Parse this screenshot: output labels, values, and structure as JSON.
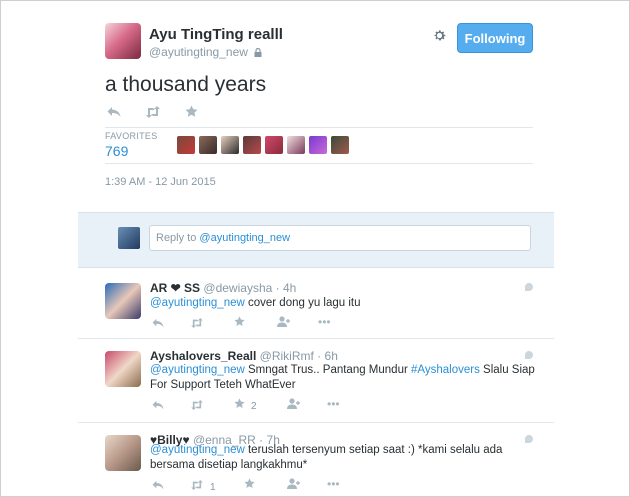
{
  "main_tweet": {
    "name": "Ayu TingTing realll",
    "handle": "@ayutingting_new",
    "follow_label": "Following",
    "text": "a thousand years",
    "favorites_label": "FAVORITES",
    "favorites_count": "769",
    "timestamp": "1:39 AM - 12 Jun 2015"
  },
  "reply": {
    "prefix": "Reply to ",
    "mention": "@ayutingting_new"
  },
  "replies": [
    {
      "name": "AR ❤ SS",
      "handle": "@dewiaysha",
      "time": "4h",
      "mention": "@ayutingting_new",
      "text": " cover dong yu lagu itu",
      "fav_count": ""
    },
    {
      "name": "Ayshalovers_Reall",
      "handle": "@RikiRmf",
      "time": "6h",
      "mention": "@ayutingting_new",
      "text_before_hashtag": " Smngat Trus.. Pantang Mundur ",
      "hashtag": "#Ayshalovers",
      "text_after_hashtag": " Slalu Siap",
      "text_line2": "For Support Teteh WhatEver",
      "fav_count": "2"
    },
    {
      "name": "♥Billy♥",
      "handle": "@enna_RR",
      "time": "7h",
      "mention": "@ayutingting_new",
      "text": " teruslah tersenyum setiap saat :) *kami selalu ada",
      "text_line2": "bersama disetiap langkakhmu*",
      "retweet_count": "1"
    }
  ],
  "colors": {
    "link": "#2a8fd6",
    "follow_button": "#55acee",
    "reply_box": "#e8f1f7"
  },
  "icons": [
    "reply-icon",
    "retweet-icon",
    "favorite-icon",
    "follow-icon",
    "more-icon",
    "gear-icon",
    "lock-icon",
    "conversation-icon"
  ]
}
